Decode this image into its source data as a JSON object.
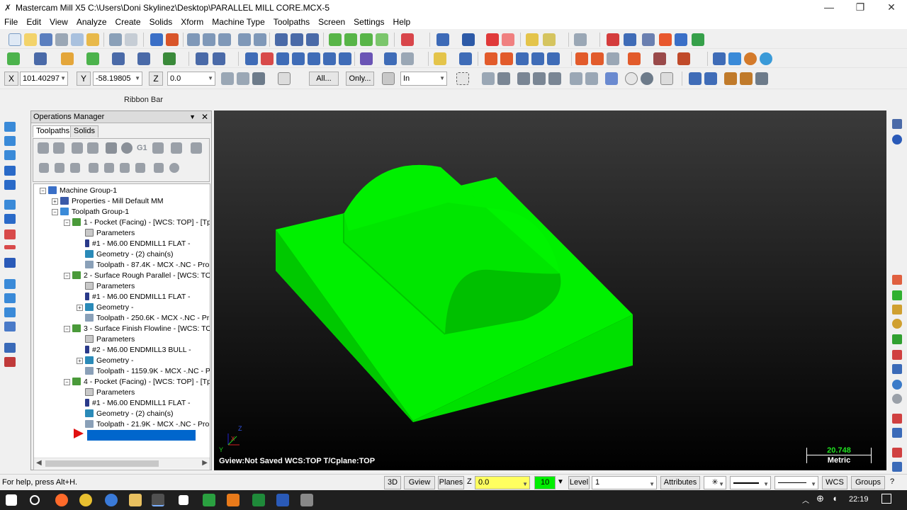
{
  "window": {
    "title": "Mastercam Mill X5  C:\\Users\\Doni Skylinez\\Desktop\\PARALLEL MILL CORE.MCX-5",
    "minimize": "—",
    "maximize": "❐",
    "close": "✕"
  },
  "menu": [
    "File",
    "Edit",
    "View",
    "Analyze",
    "Create",
    "Solids",
    "Xform",
    "Machine Type",
    "Toolpaths",
    "Screen",
    "Settings",
    "Help"
  ],
  "coords": {
    "x_label": "X",
    "x_value": "101.40297",
    "y_label": "Y",
    "y_value": "-58.19805",
    "z_label": "Z",
    "z_value": "0.0",
    "all_btn": "All...",
    "only_btn": "Only...",
    "units_value": "In"
  },
  "ribbon_label": "Ribbon Bar",
  "opmgr": {
    "title": "Operations Manager",
    "tabs": [
      "Toolpaths",
      "Solids"
    ],
    "toolbar_g1": "G1",
    "tree": [
      {
        "label": "Machine Group-1"
      },
      {
        "label": "Properties - Mill Default MM"
      },
      {
        "label": "Toolpath Group-1"
      },
      {
        "label": "1 - Pocket (Facing) - [WCS: TOP] - [Tp"
      },
      {
        "label": "Parameters"
      },
      {
        "label": "#1 - M6.00 ENDMILL1 FLAT -"
      },
      {
        "label": "Geometry - (2) chain(s)"
      },
      {
        "label": "Toolpath - 87.4K - MCX -.NC - Pro"
      },
      {
        "label": "2 - Surface Rough Parallel - [WCS: TO"
      },
      {
        "label": "Parameters"
      },
      {
        "label": "#1 - M6.00 ENDMILL1 FLAT -"
      },
      {
        "label": "Geometry -"
      },
      {
        "label": "Toolpath - 250.6K - MCX -.NC - Pr"
      },
      {
        "label": "3 - Surface Finish Flowline - [WCS: TO"
      },
      {
        "label": "Parameters"
      },
      {
        "label": "#2 - M6.00 ENDMILL3 BULL -"
      },
      {
        "label": "Geometry -"
      },
      {
        "label": "Toolpath - 1159.9K - MCX -.NC - P"
      },
      {
        "label": "4 - Pocket (Facing) - [WCS: TOP] - [Tp"
      },
      {
        "label": "Parameters"
      },
      {
        "label": "#1 - M6.00 ENDMILL1 FLAT -"
      },
      {
        "label": "Geometry - (2) chain(s)"
      },
      {
        "label": "Toolpath - 21.9K - MCX -.NC - Pro"
      }
    ]
  },
  "viewport": {
    "status": "Gview:Not Saved   WCS:TOP   T/Cplane:TOP",
    "scale_value": "20.748",
    "scale_unit": "Metric",
    "axis_x": "X",
    "axis_y": "Y",
    "axis_z": "Z",
    "part_color": "#00ee00"
  },
  "status": {
    "help": "For help, press Alt+H.",
    "btn_3d": "3D",
    "gview": "Gview",
    "planes": "Planes",
    "z_label": "Z",
    "z_value": "0.0",
    "color_value": "10",
    "level_label": "Level",
    "level_value": "1",
    "attributes": "Attributes",
    "wcs": "WCS",
    "groups": "Groups"
  },
  "taskbar": {
    "time": "22:19"
  },
  "colors": {
    "accent": "#0066cc",
    "selection": "#0066cc"
  }
}
